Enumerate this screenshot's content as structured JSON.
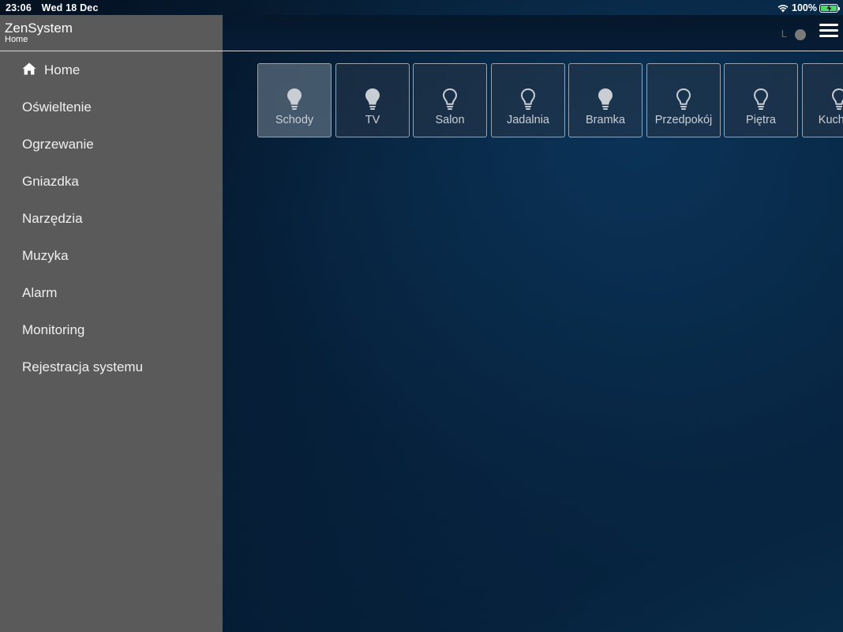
{
  "status_bar": {
    "time": "23:06",
    "date": "Wed 18 Dec",
    "battery": "100%"
  },
  "sidebar": {
    "title": "ZenSystem",
    "subtitle": "Home",
    "items": [
      {
        "label": "Home",
        "icon": "home-icon"
      },
      {
        "label": "Oświeltenie"
      },
      {
        "label": "Ogrzewanie"
      },
      {
        "label": "Gniazdka"
      },
      {
        "label": "Narzędzia"
      },
      {
        "label": "Muzyka"
      },
      {
        "label": "Alarm"
      },
      {
        "label": "Monitoring"
      },
      {
        "label": "Rejestracja systemu"
      }
    ]
  },
  "topbar": {
    "indicator_letter": "L",
    "menu_icon": "hamburger-icon"
  },
  "tiles": [
    {
      "label": "Schody",
      "bulb": "filled",
      "active": true
    },
    {
      "label": "TV",
      "bulb": "filled",
      "active": false
    },
    {
      "label": "Salon",
      "bulb": "outline",
      "active": false
    },
    {
      "label": "Jadalnia",
      "bulb": "outline",
      "active": false
    },
    {
      "label": "Bramka",
      "bulb": "filled",
      "active": false
    },
    {
      "label": "Przedpokój",
      "bulb": "outline",
      "active": false
    },
    {
      "label": "Piętra",
      "bulb": "outline",
      "active": false
    },
    {
      "label": "Kuchnia",
      "bulb": "outline",
      "active": false
    }
  ],
  "colors": {
    "sidebar_bg": "#5a5a5a",
    "main_bg": "#082846",
    "battery_green": "#4cd964"
  }
}
